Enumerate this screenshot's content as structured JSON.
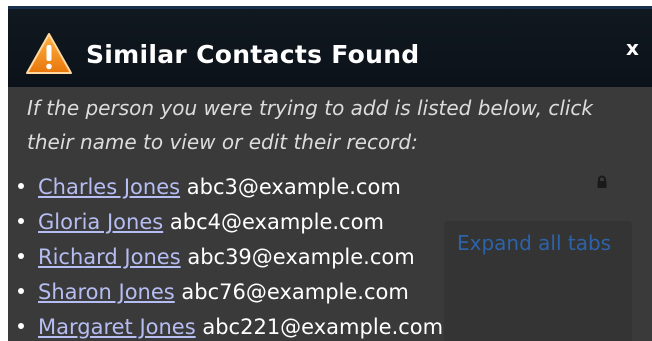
{
  "dialog": {
    "title": "Similar Contacts Found",
    "close_label": "x",
    "intro": "If the person you were trying to add is listed below, click their name to view or edit their record:"
  },
  "contacts": [
    {
      "name": "Charles Jones",
      "email": "abc3@example.com"
    },
    {
      "name": "Gloria Jones",
      "email": "abc4@example.com"
    },
    {
      "name": "Richard Jones",
      "email": "abc39@example.com"
    },
    {
      "name": "Sharon Jones",
      "email": "abc76@example.com"
    },
    {
      "name": "Margaret Jones",
      "email": "abc221@example.com"
    }
  ],
  "background": {
    "expand_all_tabs": "Expand all tabs"
  },
  "colors": {
    "title_bar": "#0f161e",
    "dialog_body": "#3a3a3a",
    "link": "#b6bdf2",
    "warning": "#f28a14"
  },
  "icons": {
    "warning": "warning-triangle-icon",
    "lock": "lock-icon",
    "close": "close-icon"
  }
}
